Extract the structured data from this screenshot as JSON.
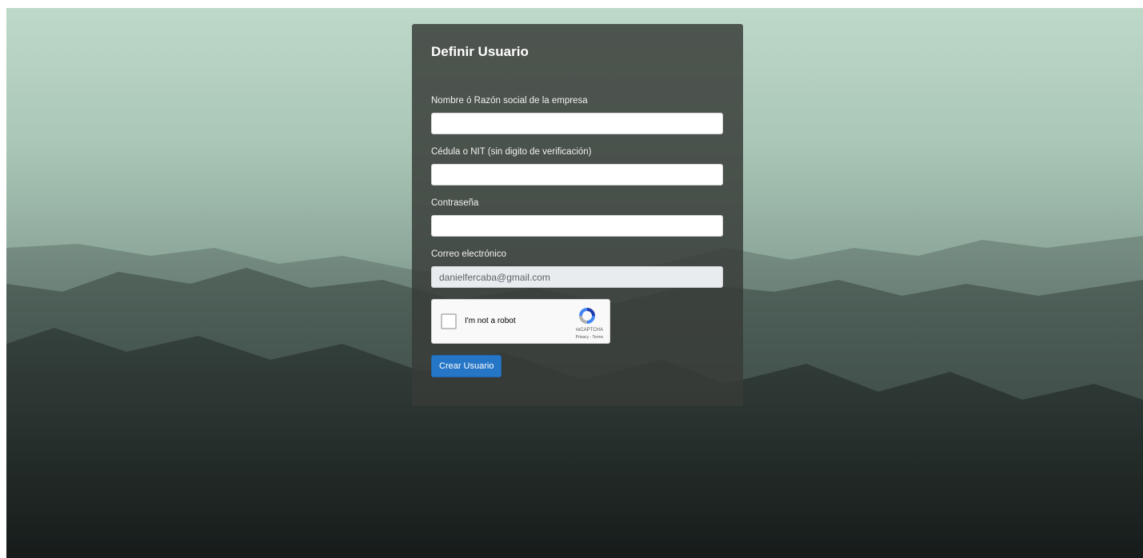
{
  "form": {
    "title": "Definir Usuario",
    "fields": [
      {
        "label": "Nombre ó Razón social de la empresa",
        "value": "",
        "readonly": false
      },
      {
        "label": "Cédula o NIT (sin digito de verificación)",
        "value": "",
        "readonly": false
      },
      {
        "label": "Contraseña",
        "value": "",
        "readonly": false
      },
      {
        "label": "Correo electrónico",
        "value": "danielfercaba@gmail.com",
        "readonly": true
      }
    ],
    "recaptcha": {
      "label": "I'm not a robot",
      "brand": "reCAPTCHA",
      "links": "Privacy - Terms",
      "icon": "recaptcha-logo-icon"
    },
    "submit_label": "Crear Usuario"
  },
  "colors": {
    "card_background": "#383c38",
    "button": "#2676c8",
    "readonly_input": "#e9ecef"
  }
}
